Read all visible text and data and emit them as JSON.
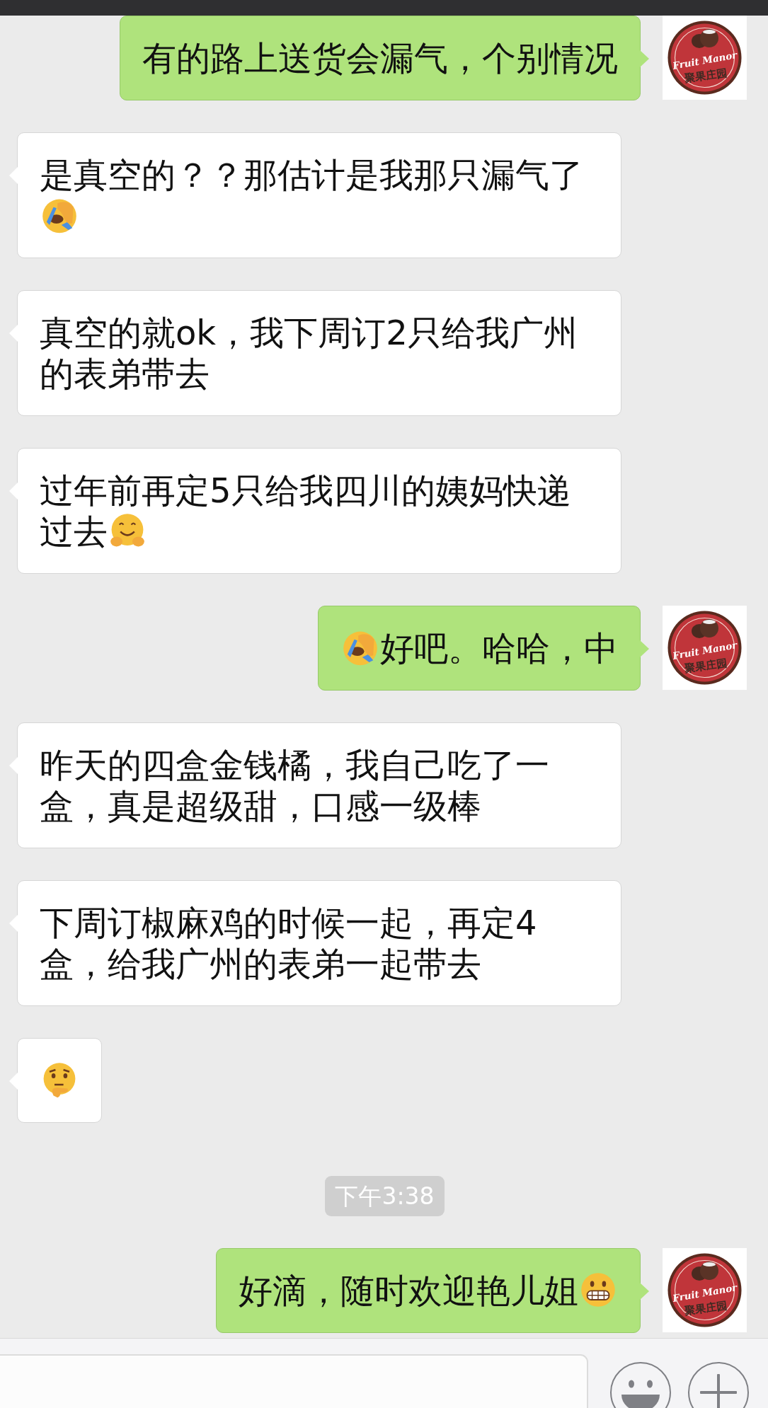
{
  "messages": [
    {
      "kind": "outgoing",
      "parts": [
        {
          "kind": "text",
          "text": "有的路上送货会漏气，个别情况"
        }
      ],
      "avatar": {
        "title": "Fruit Manor",
        "subtitle": "聚果庄园"
      }
    },
    {
      "kind": "incoming",
      "parts": [
        {
          "kind": "text",
          "text": "是真空的？？那估计是我那只漏气了"
        },
        {
          "kind": "facepalm"
        }
      ]
    },
    {
      "kind": "incoming",
      "parts": [
        {
          "kind": "text",
          "text": "真空的就ok，我下周订2只给我广州的表弟带去"
        }
      ]
    },
    {
      "kind": "incoming",
      "parts": [
        {
          "kind": "text",
          "text": "过年前再定5只给我四川的姨妈快递"
        },
        {
          "kind": "text",
          "text": "过去"
        },
        {
          "kind": "hugging"
        }
      ]
    },
    {
      "kind": "outgoing",
      "parts": [
        {
          "kind": "facepalm"
        },
        {
          "kind": "text",
          "text": "好吧。哈哈，中"
        }
      ],
      "avatar": {
        "title": "Fruit Manor",
        "subtitle": "聚果庄园"
      }
    },
    {
      "kind": "incoming",
      "parts": [
        {
          "kind": "text",
          "text": "昨天的四盒金钱橘，我自己吃了一盒，真是超级甜，口感一级棒"
        }
      ]
    },
    {
      "kind": "incoming",
      "parts": [
        {
          "kind": "text",
          "text": "下周订椒麻鸡的时候一起，再定4盒，给我广州的表弟一起带去"
        }
      ]
    },
    {
      "kind": "incoming",
      "parts": [
        {
          "kind": "thinking"
        }
      ]
    },
    {
      "kind": "time",
      "text": "下午3:38"
    },
    {
      "kind": "outgoing",
      "parts": [
        {
          "kind": "text",
          "text": "好滴，随时欢迎艳儿姐"
        },
        {
          "kind": "grin"
        }
      ],
      "avatar": {
        "title": "Fruit Manor",
        "subtitle": "聚果庄园"
      }
    }
  ]
}
